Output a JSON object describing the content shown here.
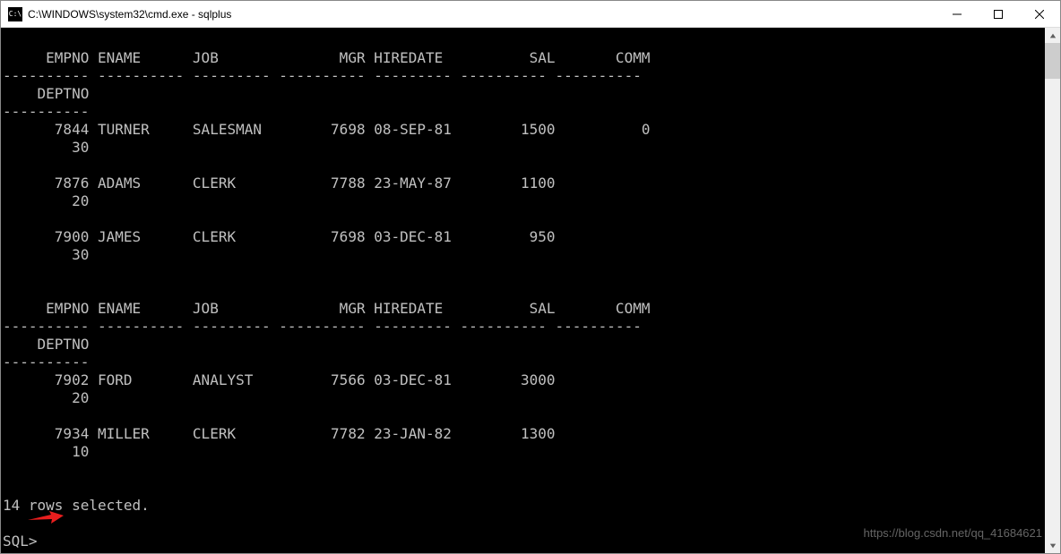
{
  "window": {
    "title": "C:\\WINDOWS\\system32\\cmd.exe - sqlplus",
    "icon_label": "C:\\"
  },
  "terminal": {
    "header_row1": "     EMPNO ENAME      JOB              MGR HIREDATE          SAL       COMM",
    "header_divider": "---------- ---------- --------- ---------- --------- ---------- ----------",
    "header_row2": "    DEPTNO",
    "header_divider2": "----------",
    "rows_block1": [
      {
        "line1": "      7844 TURNER     SALESMAN        7698 08-SEP-81        1500          0",
        "line2": "        30"
      },
      {
        "line1": "      7876 ADAMS      CLERK           7788 23-MAY-87        1100",
        "line2": "        20"
      },
      {
        "line1": "      7900 JAMES      CLERK           7698 03-DEC-81         950",
        "line2": "        30"
      }
    ],
    "rows_block2": [
      {
        "line1": "      7902 FORD       ANALYST         7566 03-DEC-81        3000",
        "line2": "        20"
      },
      {
        "line1": "      7934 MILLER     CLERK           7782 23-JAN-82        1300",
        "line2": "        10"
      }
    ],
    "summary": "14 rows selected.",
    "prompt": "SQL> "
  },
  "watermark": "https://blog.csdn.net/qq_41684621",
  "chart_data": {
    "type": "table",
    "title": "SQL*Plus EMP table output",
    "columns": [
      "EMPNO",
      "ENAME",
      "JOB",
      "MGR",
      "HIREDATE",
      "SAL",
      "COMM",
      "DEPTNO"
    ],
    "rows": [
      {
        "EMPNO": 7844,
        "ENAME": "TURNER",
        "JOB": "SALESMAN",
        "MGR": 7698,
        "HIREDATE": "08-SEP-81",
        "SAL": 1500,
        "COMM": 0,
        "DEPTNO": 30
      },
      {
        "EMPNO": 7876,
        "ENAME": "ADAMS",
        "JOB": "CLERK",
        "MGR": 7788,
        "HIREDATE": "23-MAY-87",
        "SAL": 1100,
        "COMM": null,
        "DEPTNO": 20
      },
      {
        "EMPNO": 7900,
        "ENAME": "JAMES",
        "JOB": "CLERK",
        "MGR": 7698,
        "HIREDATE": "03-DEC-81",
        "SAL": 950,
        "COMM": null,
        "DEPTNO": 30
      },
      {
        "EMPNO": 7902,
        "ENAME": "FORD",
        "JOB": "ANALYST",
        "MGR": 7566,
        "HIREDATE": "03-DEC-81",
        "SAL": 3000,
        "COMM": null,
        "DEPTNO": 20
      },
      {
        "EMPNO": 7934,
        "ENAME": "MILLER",
        "JOB": "CLERK",
        "MGR": 7782,
        "HIREDATE": "23-JAN-82",
        "SAL": 1300,
        "COMM": null,
        "DEPTNO": 10
      }
    ],
    "rows_selected": 14
  }
}
